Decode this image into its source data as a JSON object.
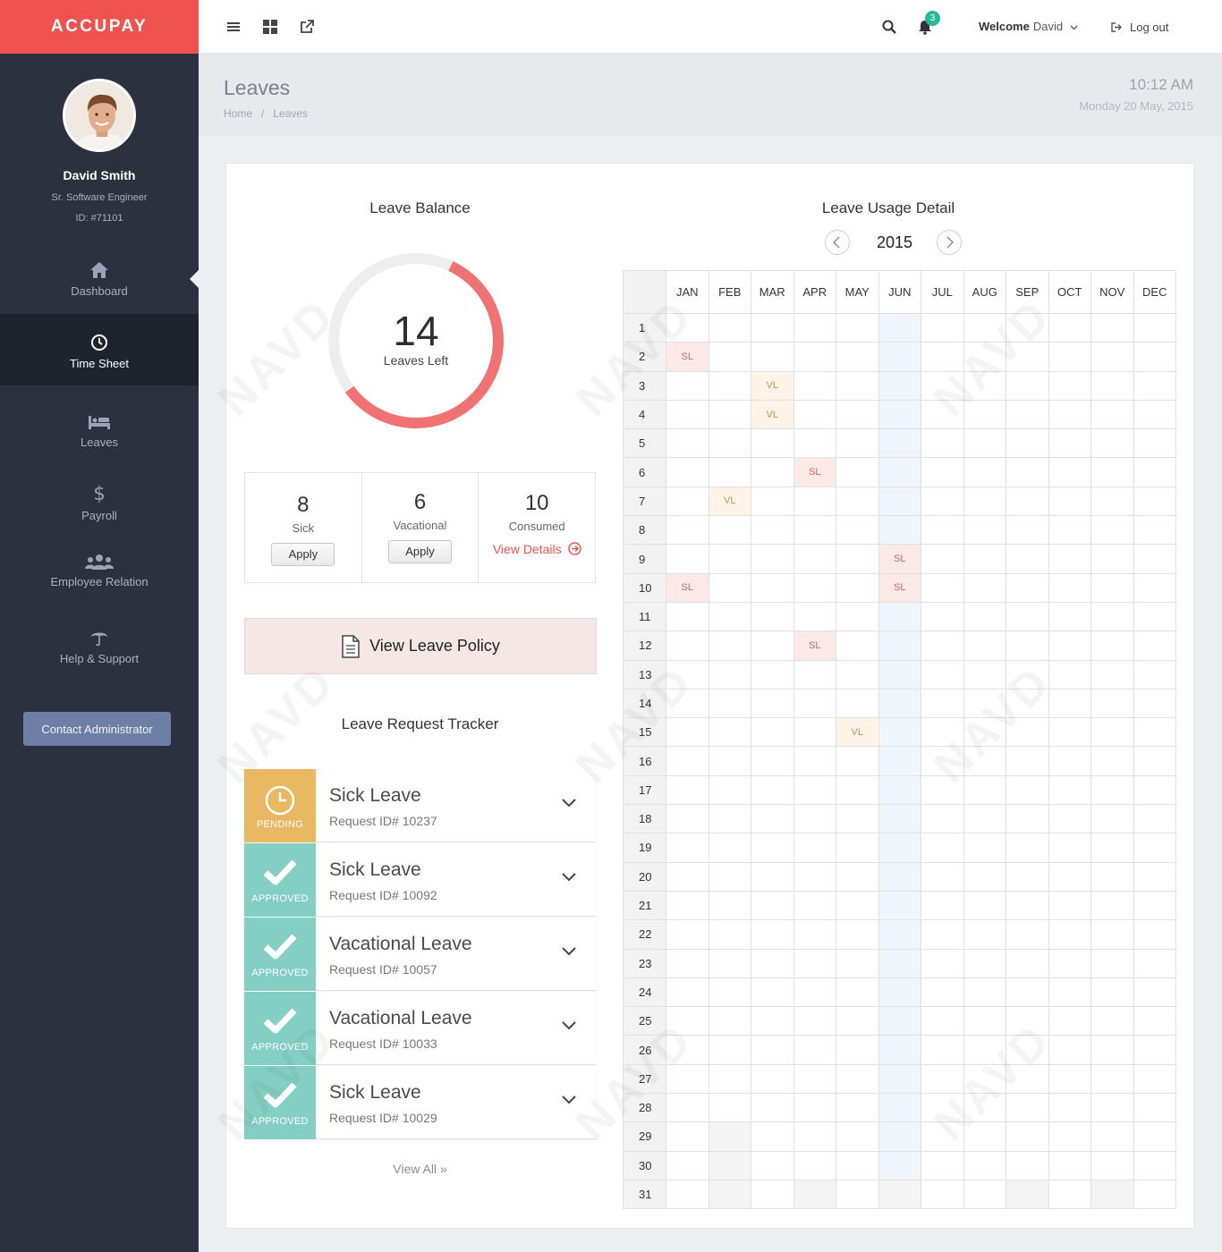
{
  "brand": "ACCUPAY",
  "profile": {
    "name": "David Smith",
    "role": "Sr. Software Engineer",
    "id": "ID: #71101"
  },
  "nav": [
    {
      "label": "Dashboard",
      "icon": "home-icon"
    },
    {
      "label": "Time Sheet",
      "icon": "clock-icon"
    },
    {
      "label": "Leaves",
      "icon": "bed-icon"
    },
    {
      "label": "Payroll",
      "icon": "dollar-icon"
    },
    {
      "label": "Employee Relation",
      "icon": "users-icon"
    },
    {
      "label": "Help & Support",
      "icon": "umbrella-icon"
    }
  ],
  "contact_label": "Contact Administrator",
  "header": {
    "welcome": "Welcome",
    "user": "David",
    "logout": "Log out",
    "notifications": "3"
  },
  "page": {
    "title": "Leaves",
    "breadcrumb": [
      "Home",
      "Leaves"
    ],
    "time": "10:12 AM",
    "date": "Monday 20 May, 2015"
  },
  "balance": {
    "title": "Leave Balance",
    "left": "14",
    "left_label": "Leaves Left",
    "gauge_fraction": 0.58,
    "boxes": [
      {
        "num": "8",
        "label": "Sick",
        "action": "Apply"
      },
      {
        "num": "6",
        "label": "Vacational",
        "action": "Apply"
      },
      {
        "num": "10",
        "label": "Consumed",
        "action": "View Details"
      }
    ]
  },
  "policy_label": "View Leave Policy",
  "tracker": {
    "title": "Leave Request Tracker",
    "items": [
      {
        "status": "PENDING",
        "type": "Sick Leave",
        "id": "Request ID# 10237"
      },
      {
        "status": "APPROVED",
        "type": "Sick Leave",
        "id": "Request ID# 10092"
      },
      {
        "status": "APPROVED",
        "type": "Vacational Leave",
        "id": "Request ID# 10057"
      },
      {
        "status": "APPROVED",
        "type": "Vacational Leave",
        "id": "Request ID# 10033"
      },
      {
        "status": "APPROVED",
        "type": "Sick Leave",
        "id": "Request ID# 10029"
      }
    ],
    "view_all": "View All"
  },
  "usage": {
    "title": "Leave Usage Detail",
    "year": "2015",
    "months": [
      "JAN",
      "FEB",
      "MAR",
      "APR",
      "MAY",
      "JUN",
      "JUL",
      "AUG",
      "SEP",
      "OCT",
      "NOV",
      "DEC"
    ],
    "days_in_month": [
      31,
      28,
      31,
      30,
      31,
      30,
      31,
      31,
      30,
      31,
      30,
      31
    ],
    "current_month": "JUN",
    "leaves": [
      {
        "month": "JAN",
        "day": 2,
        "code": "SL"
      },
      {
        "month": "MAR",
        "day": 3,
        "code": "VL"
      },
      {
        "month": "MAR",
        "day": 4,
        "code": "VL"
      },
      {
        "month": "APR",
        "day": 6,
        "code": "SL"
      },
      {
        "month": "FEB",
        "day": 7,
        "code": "VL"
      },
      {
        "month": "JUN",
        "day": 9,
        "code": "SL"
      },
      {
        "month": "JAN",
        "day": 10,
        "code": "SL"
      },
      {
        "month": "JUN",
        "day": 10,
        "code": "SL"
      },
      {
        "month": "APR",
        "day": 12,
        "code": "SL"
      },
      {
        "month": "MAY",
        "day": 15,
        "code": "VL"
      }
    ]
  },
  "colors": {
    "brand": "#ef5350",
    "sidebar": "#2c3140",
    "pending": "#e9b863",
    "approved": "#84cfc3"
  }
}
